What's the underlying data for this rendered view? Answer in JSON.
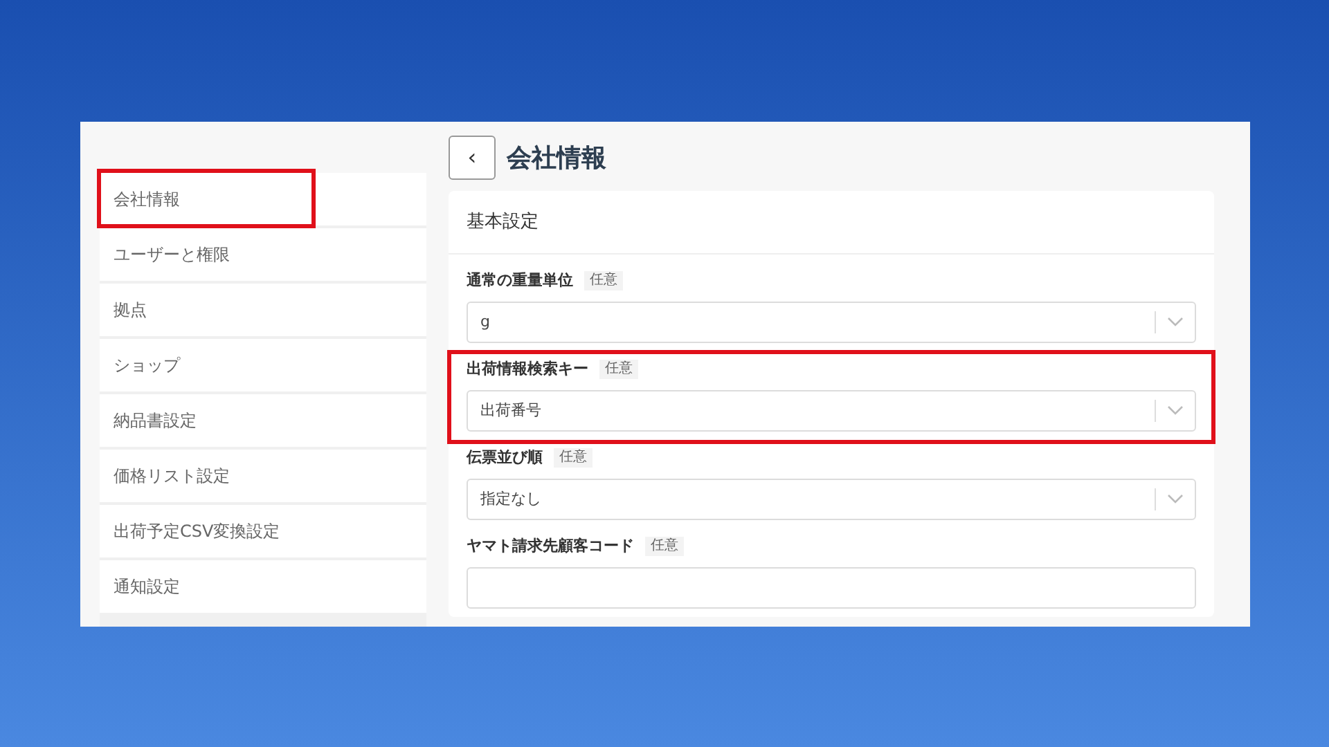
{
  "sidebar": {
    "items": [
      {
        "label": "会社情報",
        "highlighted": true
      },
      {
        "label": "ユーザーと権限",
        "highlighted": false
      },
      {
        "label": "拠点",
        "highlighted": false
      },
      {
        "label": "ショップ",
        "highlighted": false
      },
      {
        "label": "納品書設定",
        "highlighted": false
      },
      {
        "label": "価格リスト設定",
        "highlighted": false
      },
      {
        "label": "出荷予定CSV変換設定",
        "highlighted": false
      },
      {
        "label": "通知設定",
        "highlighted": false
      }
    ]
  },
  "header": {
    "back": "‹",
    "title": "会社情報"
  },
  "card": {
    "title": "基本設定",
    "fields": [
      {
        "kind": "select",
        "label": "通常の重量単位",
        "badge": "任意",
        "value": "g",
        "highlighted": false
      },
      {
        "kind": "select",
        "label": "出荷情報検索キー",
        "badge": "任意",
        "value": "出荷番号",
        "highlighted": true
      },
      {
        "kind": "select",
        "label": "伝票並び順",
        "badge": "任意",
        "value": "指定なし",
        "highlighted": false
      },
      {
        "kind": "text",
        "label": "ヤマト請求先顧客コード",
        "badge": "任意",
        "highlighted": false
      }
    ]
  }
}
